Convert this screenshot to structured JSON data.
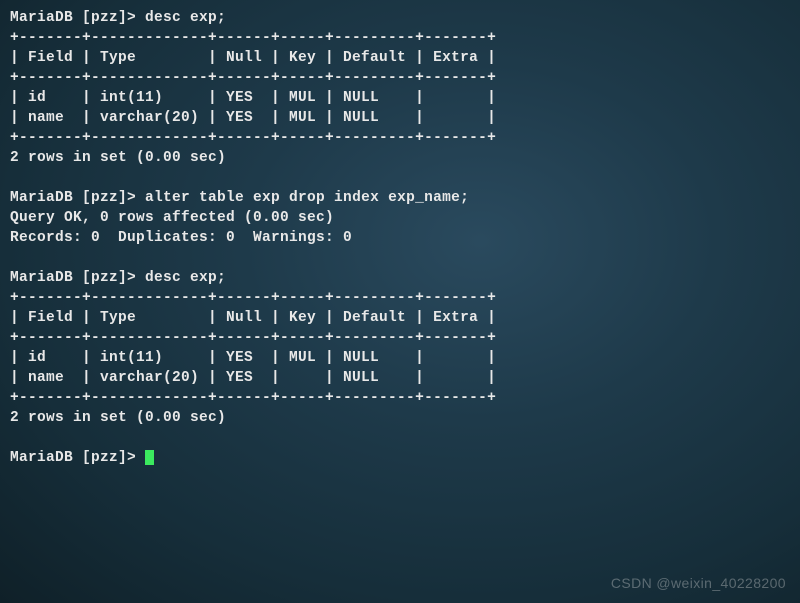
{
  "prompt": "MariaDB [pzz]> ",
  "cmd1": "desc exp;",
  "border_top": "+-------+-------------+------+-----+---------+-------+",
  "header_row": "| Field | Type        | Null | Key | Default | Extra |",
  "desc1_rows": [
    "| id    | int(11)     | YES  | MUL | NULL    |       |",
    "| name  | varchar(20) | YES  | MUL | NULL    |       |"
  ],
  "rows_msg": "2 rows in set (0.00 sec)",
  "cmd2": "alter table exp drop index exp_name;",
  "query_ok": "Query OK, 0 rows affected (0.00 sec)",
  "records_msg": "Records: 0  Duplicates: 0  Warnings: 0",
  "cmd3": "desc exp;",
  "desc2_rows": [
    "| id    | int(11)     | YES  | MUL | NULL    |       |",
    "| name  | varchar(20) | YES  |     | NULL    |       |"
  ],
  "watermark": "CSDN @weixin_40228200",
  "chart_data": {
    "type": "table",
    "tables": [
      {
        "title": "desc exp (before drop index)",
        "columns": [
          "Field",
          "Type",
          "Null",
          "Key",
          "Default",
          "Extra"
        ],
        "rows": [
          [
            "id",
            "int(11)",
            "YES",
            "MUL",
            "NULL",
            ""
          ],
          [
            "name",
            "varchar(20)",
            "YES",
            "MUL",
            "NULL",
            ""
          ]
        ]
      },
      {
        "title": "desc exp (after drop index exp_name)",
        "columns": [
          "Field",
          "Type",
          "Null",
          "Key",
          "Default",
          "Extra"
        ],
        "rows": [
          [
            "id",
            "int(11)",
            "YES",
            "MUL",
            "NULL",
            ""
          ],
          [
            "name",
            "varchar(20)",
            "YES",
            "",
            "NULL",
            ""
          ]
        ]
      }
    ]
  }
}
